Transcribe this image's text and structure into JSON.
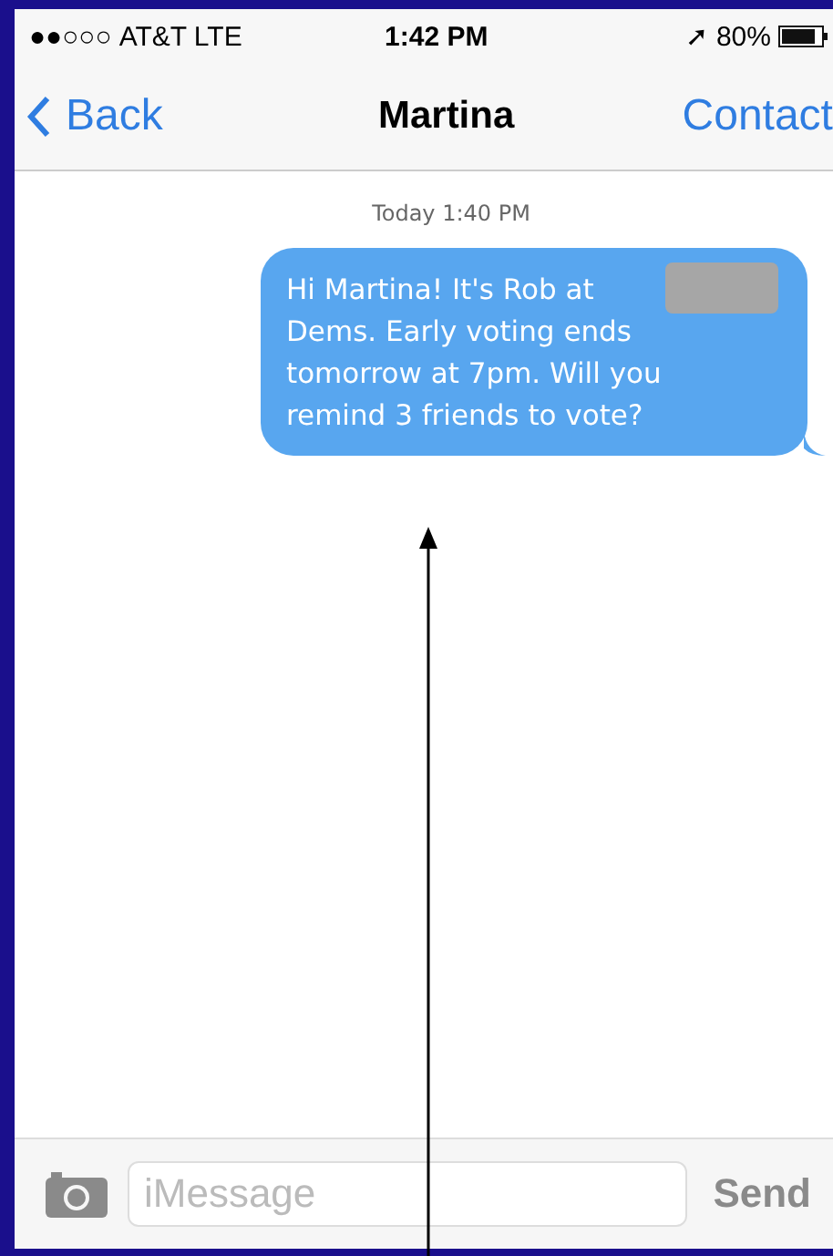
{
  "status_bar": {
    "signal": "●●○○○",
    "carrier": "AT&T LTE",
    "time": "1:42 PM",
    "location_arrow": "➚",
    "battery": "80%"
  },
  "nav": {
    "back": "Back",
    "title": "Martina",
    "action": "Contact"
  },
  "timestamp": "Today 1:40 PM",
  "messages": [
    {
      "text": "Hi Martina! It's Rob at\nDems. Early voting ends\ntomorrow at 7pm. Will you\nremind 3 friends to vote?",
      "redacted": true
    }
  ],
  "composer": {
    "placeholder": "iMessage",
    "send": "Send"
  }
}
